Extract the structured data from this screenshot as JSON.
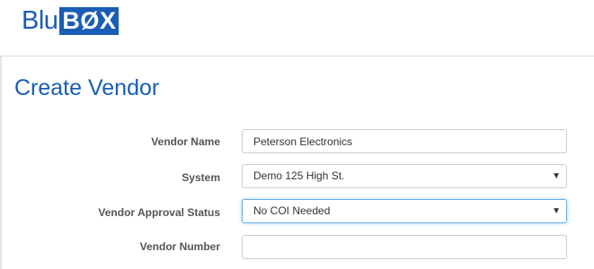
{
  "header": {
    "logo_prefix": "Blu",
    "logo_box": "BØX"
  },
  "page": {
    "title": "Create Vendor"
  },
  "form": {
    "vendor_name": {
      "label": "Vendor Name",
      "value": "Peterson Electronics"
    },
    "system": {
      "label": "System",
      "selected": "Demo 125 High St.",
      "icon": "chevron-down-icon"
    },
    "approval_status": {
      "label": "Vendor Approval Status",
      "selected": "No COI Needed",
      "icon": "chevron-down-icon"
    },
    "vendor_number": {
      "label": "Vendor Number",
      "value": ""
    }
  },
  "colors": {
    "brand": "#1a5db4",
    "label": "#555555",
    "focus_border": "#66afe9"
  }
}
